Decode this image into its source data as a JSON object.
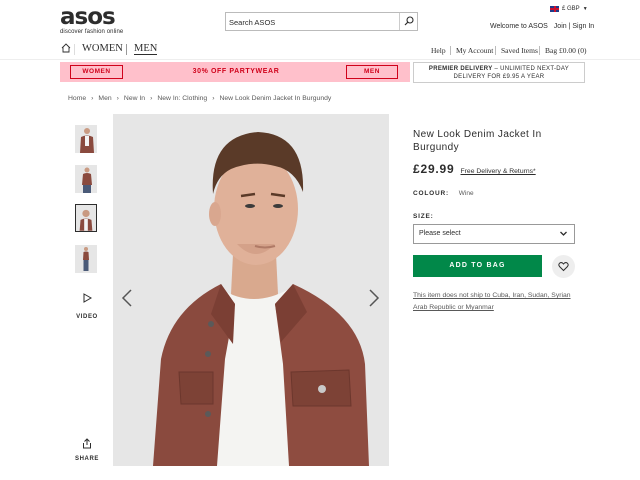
{
  "header": {
    "logo_word": "asos",
    "logo_tagline": "discover fashion online",
    "search_placeholder": "Search ASOS",
    "currency": "£ GBP",
    "welcome": "Welcome to ASOS",
    "join": "Join",
    "separator": "|",
    "signin": "Sign In"
  },
  "nav": {
    "women": "WOMEN",
    "men": "MEN",
    "help": "Help",
    "my_account": "My Account",
    "saved_items": "Saved Items",
    "bag": "Bag £0.00 (0)"
  },
  "promo": {
    "women_btn": "WOMEN",
    "text": "30% OFF PARTYWEAR",
    "men_btn": "MEN",
    "delivery_bold": "PREMIER DELIVERY",
    "delivery_rest": " – UNLIMITED NEXT-DAY",
    "delivery_line2": "DELIVERY FOR £9.95 A YEAR"
  },
  "breadcrumb": [
    "Home",
    "Men",
    "New In",
    "New In: Clothing",
    "New Look Denim Jacket In Burgundy"
  ],
  "gallery": {
    "video_label": "VIDEO",
    "share_label": "SHARE",
    "active_thumb": 3
  },
  "product": {
    "title": "New Look Denim Jacket In Burgundy",
    "price": "£29.99",
    "free_delivery": "Free Delivery & Returns*",
    "colour_label": "COLOUR:",
    "colour_value": "Wine",
    "size_label": "SIZE:",
    "size_placeholder": "Please select",
    "add_to_bag": "ADD TO BAG",
    "shipping_note": "This item does not ship to Cuba, Iran, Sudan, Syrian Arab Republic or Myanmar"
  },
  "colors": {
    "promo_bg": "#ffc0cb",
    "promo_red": "#d0021b",
    "add_to_bag_green": "#018849",
    "jacket": "#8a4a3e"
  }
}
